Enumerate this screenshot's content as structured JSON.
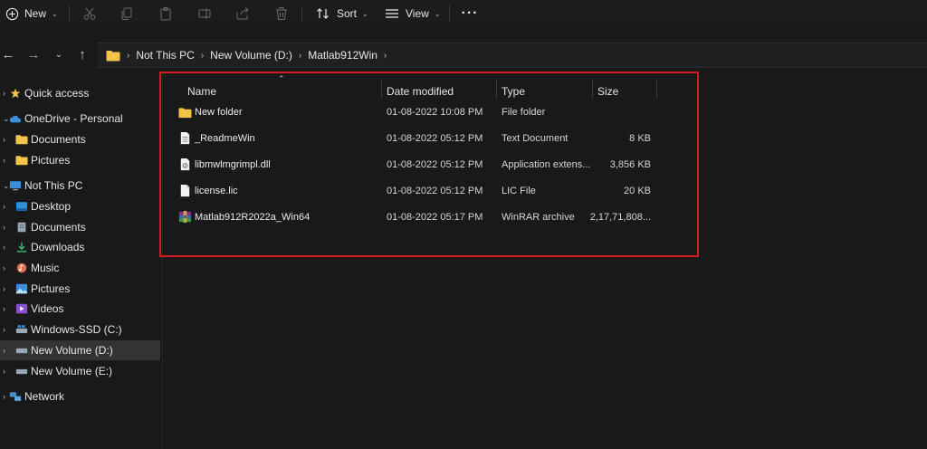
{
  "toolbar": {
    "new_label": "New",
    "sort_label": "Sort",
    "view_label": "View",
    "icons": [
      "cut-icon",
      "copy-icon",
      "paste-icon",
      "rename-icon",
      "share-icon",
      "delete-icon",
      "more-icon"
    ]
  },
  "breadcrumb": [
    "Not This PC",
    "New Volume (D:)",
    "Matlab912Win"
  ],
  "sidebar": {
    "items": [
      {
        "label": "Quick access"
      },
      {
        "label": "OneDrive - Personal"
      },
      {
        "label": "Documents"
      },
      {
        "label": "Pictures"
      },
      {
        "label": "Not This PC"
      },
      {
        "label": "Desktop"
      },
      {
        "label": "Documents"
      },
      {
        "label": "Downloads"
      },
      {
        "label": "Music"
      },
      {
        "label": "Pictures"
      },
      {
        "label": "Videos"
      },
      {
        "label": "Windows-SSD (C:)"
      },
      {
        "label": "New Volume (D:)",
        "selected": true
      },
      {
        "label": "New Volume (E:)"
      },
      {
        "label": "Network"
      }
    ]
  },
  "columns": {
    "name": "Name",
    "date": "Date modified",
    "type": "Type",
    "size": "Size"
  },
  "files": [
    {
      "name": "New folder",
      "date": "01-08-2022 10:08 PM",
      "type": "File folder",
      "size": "",
      "icon": "folder-icon"
    },
    {
      "name": "_ReadmeWin",
      "date": "01-08-2022 05:12 PM",
      "type": "Text Document",
      "size": "8 KB",
      "icon": "text-file-icon"
    },
    {
      "name": "libmwlmgrimpl.dll",
      "date": "01-08-2022 05:12 PM",
      "type": "Application extens...",
      "size": "3,856 KB",
      "icon": "dll-file-icon"
    },
    {
      "name": "license.lic",
      "date": "01-08-2022 05:12 PM",
      "type": "LIC File",
      "size": "20 KB",
      "icon": "file-icon"
    },
    {
      "name": "Matlab912R2022a_Win64",
      "date": "01-08-2022 05:17 PM",
      "type": "WinRAR archive",
      "size": "2,17,71,808...",
      "icon": "winrar-archive-icon"
    }
  ],
  "colors": {
    "highlight_border": "#d21c23",
    "folder": "#f3c34b",
    "background": "#191919"
  }
}
